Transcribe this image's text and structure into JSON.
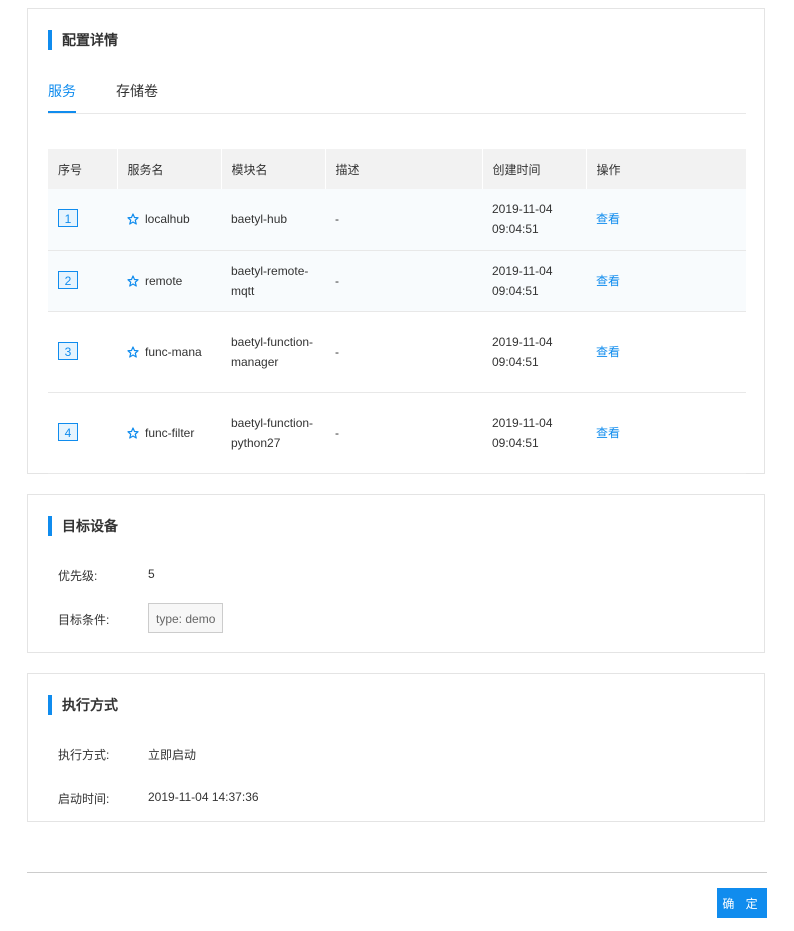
{
  "config_section": {
    "title": "配置详情",
    "tabs": [
      {
        "label": "服务",
        "active": true
      },
      {
        "label": "存储卷",
        "active": false
      }
    ],
    "table": {
      "headers": [
        "序号",
        "服务名",
        "模块名",
        "描述",
        "创建时间",
        "操作"
      ],
      "rows": [
        {
          "index": "1",
          "service": "localhub",
          "module": "baetyl-hub",
          "description": "-",
          "created_date": "2019-11-04",
          "created_time": "09:04:51",
          "action": "查看"
        },
        {
          "index": "2",
          "service": "remote",
          "module": "baetyl-remote-mqtt",
          "description": "-",
          "created_date": "2019-11-04",
          "created_time": "09:04:51",
          "action": "查看"
        },
        {
          "index": "3",
          "service": "func-mana",
          "module": "baetyl-function-manager",
          "description": "-",
          "created_date": "2019-11-04",
          "created_time": "09:04:51",
          "action": "查看"
        },
        {
          "index": "4",
          "service": "func-filter",
          "module": "baetyl-function-python27",
          "description": "-",
          "created_date": "2019-11-04",
          "created_time": "09:04:51",
          "action": "查看"
        }
      ]
    }
  },
  "target_section": {
    "title": "目标设备",
    "priority_label": "优先级:",
    "priority_value": "5",
    "condition_label": "目标条件:",
    "condition_value": "type: demo"
  },
  "exec_section": {
    "title": "执行方式",
    "mode_label": "执行方式:",
    "mode_value": "立即启动",
    "start_label": "启动时间:",
    "start_value": "2019-11-04 14:37:36"
  },
  "footer": {
    "confirm_label": "确 定"
  },
  "colors": {
    "accent": "#108cee",
    "border": "#e4e4e4",
    "header_bg": "#f2f2f2"
  },
  "icons": {
    "service": "star-icon"
  }
}
